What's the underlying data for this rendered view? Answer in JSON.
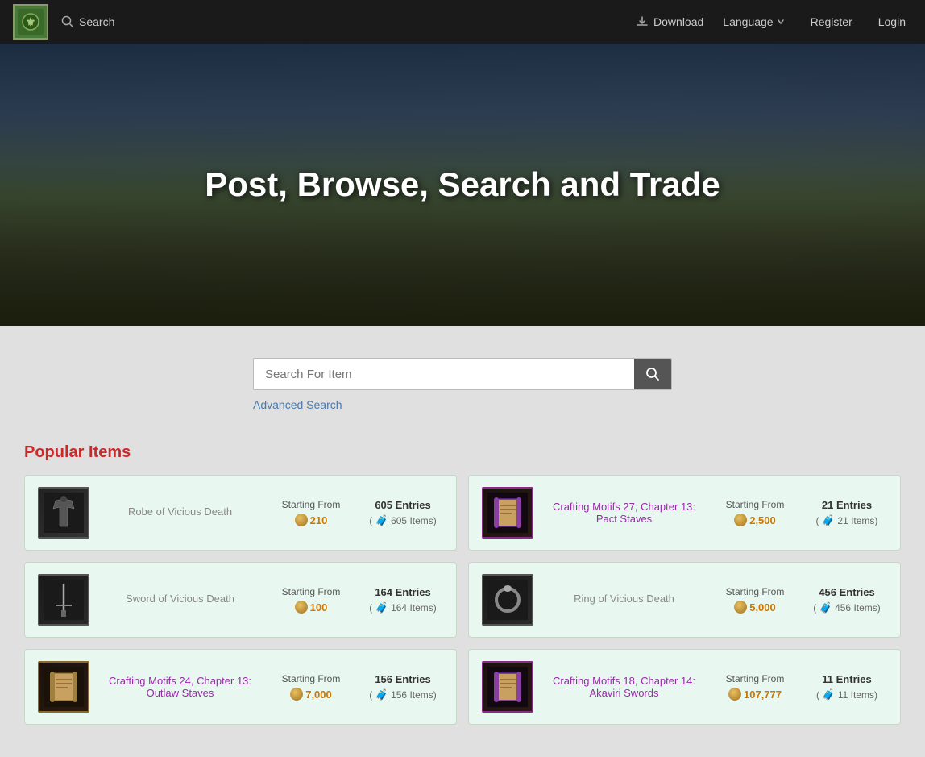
{
  "navbar": {
    "logo_alt": "MMO Traders",
    "search_label": "Search",
    "download_label": "Download",
    "language_label": "Language",
    "register_label": "Register",
    "login_label": "Login"
  },
  "hero": {
    "title": "Post, Browse, Search and Trade"
  },
  "search": {
    "placeholder": "Search For Item",
    "button_icon": "🔍",
    "advanced_label": "Advanced Search"
  },
  "popular": {
    "section_title": "Popular Items",
    "items": [
      {
        "id": "robe-vicious-death",
        "name": "Robe of Vicious Death",
        "name_is_link": false,
        "icon_type": "robe",
        "starting_from_label": "Starting From",
        "price": "210",
        "entries_count": "605",
        "entries_label": "Entries",
        "items_count": "605",
        "items_suffix": "Items"
      },
      {
        "id": "crafting-motifs-27",
        "name": "Crafting Motifs 27, Chapter 13: Pact Staves",
        "name_is_link": true,
        "icon_type": "scroll-purple",
        "starting_from_label": "Starting From",
        "price": "2,500",
        "entries_count": "21",
        "entries_label": "Entries",
        "items_count": "21",
        "items_suffix": "Items"
      },
      {
        "id": "sword-vicious-death",
        "name": "Sword of Vicious Death",
        "name_is_link": false,
        "icon_type": "sword",
        "starting_from_label": "Starting From",
        "price": "100",
        "entries_count": "164",
        "entries_label": "Entries",
        "items_count": "164",
        "items_suffix": "Items"
      },
      {
        "id": "ring-vicious-death",
        "name": "Ring of Vicious Death",
        "name_is_link": false,
        "icon_type": "ring",
        "starting_from_label": "Starting From",
        "price": "5,000",
        "entries_count": "456",
        "entries_label": "Entries",
        "items_count": "456",
        "items_suffix": "Items"
      },
      {
        "id": "crafting-motifs-24",
        "name": "Crafting Motifs 24, Chapter 13: Outlaw Staves",
        "name_is_link": true,
        "icon_type": "scroll",
        "starting_from_label": "Starting From",
        "price": "7,000",
        "entries_count": "156",
        "entries_label": "Entries",
        "items_count": "156",
        "items_suffix": "Items"
      },
      {
        "id": "crafting-motifs-18",
        "name": "Crafting Motifs 18, Chapter 14: Akaviri Swords",
        "name_is_link": true,
        "icon_type": "scroll-purple",
        "starting_from_label": "Starting From",
        "price": "107,777",
        "entries_count": "11",
        "entries_label": "Entries",
        "items_count": "11",
        "items_suffix": "Items"
      }
    ]
  }
}
